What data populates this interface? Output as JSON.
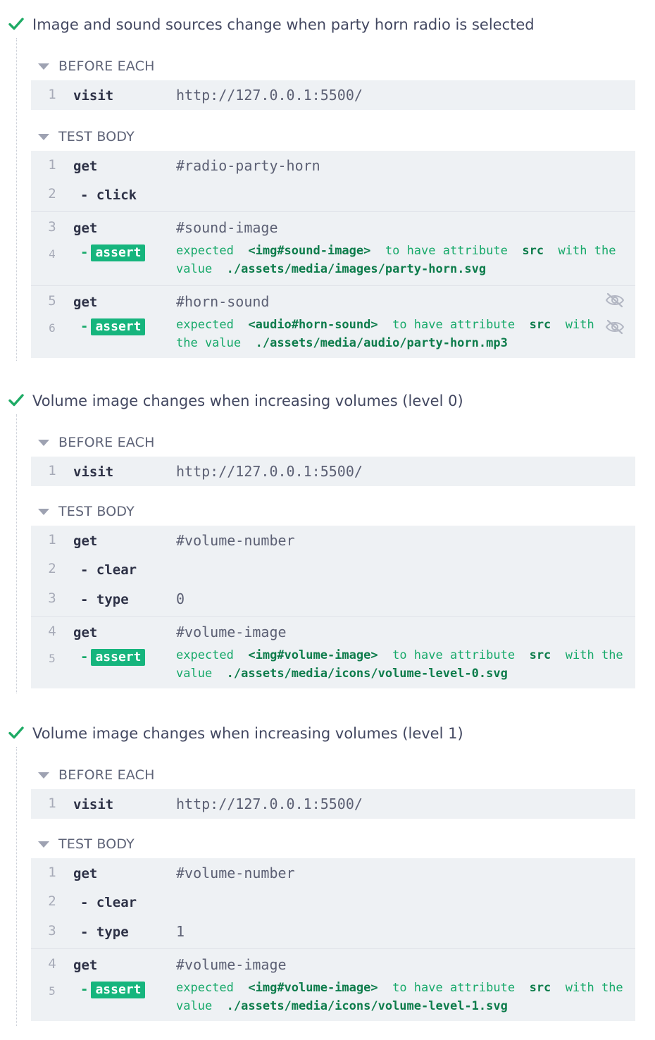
{
  "colors": {
    "pass_check": "#1eab65",
    "assert_badge": "#16b57d",
    "command_block_bg": "#eef1f4"
  },
  "tests": [
    {
      "title": "Image and sound sources change when party horn radio is selected",
      "before_each_label": "BEFORE EACH",
      "test_body_label": "TEST BODY",
      "before_each": [
        {
          "num": "1",
          "name": "visit",
          "message": "http://127.0.0.1:5500/"
        }
      ],
      "body_groups": [
        {
          "parent": {
            "num": "1",
            "name": "get",
            "message": "#radio-party-horn"
          },
          "children": [
            {
              "num": "2",
              "name": "click"
            }
          ]
        },
        {
          "parent": {
            "num": "3",
            "name": "get",
            "message": "#sound-image"
          },
          "assert": {
            "num": "4",
            "label": "assert",
            "expected": "expected",
            "subject": "<img#sound-image>",
            "verb": "to have attribute",
            "attr": "src",
            "with_text": "with the",
            "value_text": "value",
            "value": "./assets/media/images/party-horn.svg"
          }
        },
        {
          "parent": {
            "num": "5",
            "name": "get",
            "message": "#horn-sound",
            "icon": "eye-slash-icon"
          },
          "assert": {
            "num": "6",
            "label": "assert",
            "expected": "expected",
            "subject": "<audio#horn-sound>",
            "verb": "to have attribute",
            "attr": "src",
            "with_text": "with",
            "value_text": "the value",
            "value": "./assets/media/audio/party-horn.mp3",
            "icon": "eye-slash-icon"
          }
        }
      ]
    },
    {
      "title": "Volume image changes when increasing volumes (level 0)",
      "before_each_label": "BEFORE EACH",
      "test_body_label": "TEST BODY",
      "before_each": [
        {
          "num": "1",
          "name": "visit",
          "message": "http://127.0.0.1:5500/"
        }
      ],
      "body_groups": [
        {
          "parent": {
            "num": "1",
            "name": "get",
            "message": "#volume-number"
          },
          "children": [
            {
              "num": "2",
              "name": "clear"
            },
            {
              "num": "3",
              "name": "type",
              "message": "0"
            }
          ]
        },
        {
          "parent": {
            "num": "4",
            "name": "get",
            "message": "#volume-image"
          },
          "assert": {
            "num": "5",
            "label": "assert",
            "expected": "expected",
            "subject": "<img#volume-image>",
            "verb": "to have attribute",
            "attr": "src",
            "with_text": "with the",
            "value_text": "value",
            "value": "./assets/media/icons/volume-level-0.svg"
          }
        }
      ]
    },
    {
      "title": "Volume image changes when increasing volumes (level 1)",
      "before_each_label": "BEFORE EACH",
      "test_body_label": "TEST BODY",
      "before_each": [
        {
          "num": "1",
          "name": "visit",
          "message": "http://127.0.0.1:5500/"
        }
      ],
      "body_groups": [
        {
          "parent": {
            "num": "1",
            "name": "get",
            "message": "#volume-number"
          },
          "children": [
            {
              "num": "2",
              "name": "clear"
            },
            {
              "num": "3",
              "name": "type",
              "message": "1"
            }
          ]
        },
        {
          "parent": {
            "num": "4",
            "name": "get",
            "message": "#volume-image"
          },
          "assert": {
            "num": "5",
            "label": "assert",
            "expected": "expected",
            "subject": "<img#volume-image>",
            "verb": "to have attribute",
            "attr": "src",
            "with_text": "with the",
            "value_text": "value",
            "value": "./assets/media/icons/volume-level-1.svg"
          }
        }
      ]
    }
  ]
}
